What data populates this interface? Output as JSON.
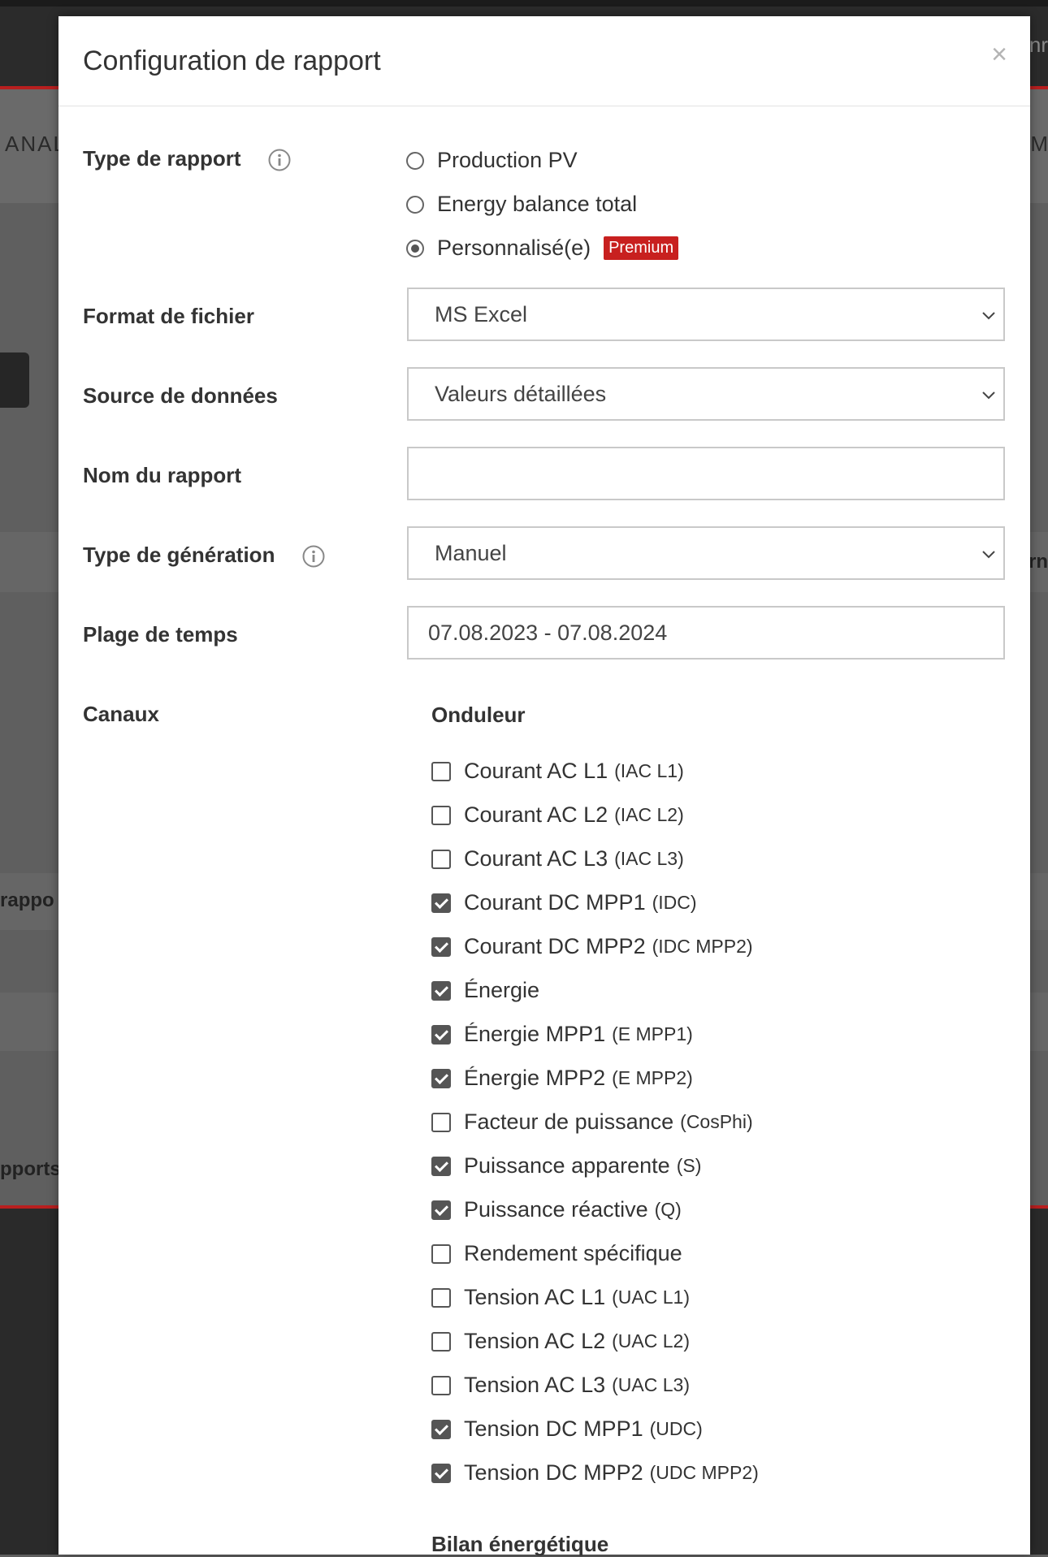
{
  "background": {
    "nav_left": "ANAL",
    "nav_right": "M",
    "header_right": "Enr",
    "row_right": "rn",
    "row_left_1": "rappo",
    "row_left_2": "pports"
  },
  "modal": {
    "title": "Configuration de rapport",
    "close_label": "×"
  },
  "report_type": {
    "label": "Type de rapport",
    "options": [
      {
        "label": "Production PV",
        "checked": false
      },
      {
        "label": "Energy balance total",
        "checked": false
      },
      {
        "label": "Personnalisé(e)",
        "checked": true,
        "badge": "Premium"
      }
    ]
  },
  "file_format": {
    "label": "Format de fichier",
    "value": "MS Excel"
  },
  "data_source": {
    "label": "Source de données",
    "value": "Valeurs détaillées"
  },
  "report_name": {
    "label": "Nom du rapport",
    "value": ""
  },
  "generation_type": {
    "label": "Type de génération",
    "value": "Manuel"
  },
  "time_range": {
    "label": "Plage de temps",
    "value": "07.08.2023 - 07.08.2024"
  },
  "channels": {
    "label": "Canaux",
    "groups": [
      {
        "title": "Onduleur",
        "items": [
          {
            "label": "Courant AC L1",
            "code": "(IAC L1)",
            "checked": false
          },
          {
            "label": "Courant AC L2",
            "code": "(IAC L2)",
            "checked": false
          },
          {
            "label": "Courant AC L3",
            "code": "(IAC L3)",
            "checked": false
          },
          {
            "label": "Courant DC MPP1",
            "code": "(IDC)",
            "checked": true
          },
          {
            "label": "Courant DC MPP2",
            "code": "(IDC MPP2)",
            "checked": true
          },
          {
            "label": "Énergie",
            "code": "",
            "checked": true
          },
          {
            "label": "Énergie MPP1",
            "code": "(E MPP1)",
            "checked": true
          },
          {
            "label": "Énergie MPP2",
            "code": "(E MPP2)",
            "checked": true
          },
          {
            "label": "Facteur de puissance",
            "code": "(CosPhi)",
            "checked": false
          },
          {
            "label": "Puissance apparente",
            "code": "(S)",
            "checked": true
          },
          {
            "label": "Puissance réactive",
            "code": "(Q)",
            "checked": true
          },
          {
            "label": "Rendement spécifique",
            "code": "",
            "checked": false
          },
          {
            "label": "Tension AC L1",
            "code": "(UAC L1)",
            "checked": false
          },
          {
            "label": "Tension AC L2",
            "code": "(UAC L2)",
            "checked": false
          },
          {
            "label": "Tension AC L3",
            "code": "(UAC L3)",
            "checked": false
          },
          {
            "label": "Tension DC MPP1",
            "code": "(UDC)",
            "checked": true
          },
          {
            "label": "Tension DC MPP2",
            "code": "(UDC MPP2)",
            "checked": true
          }
        ]
      },
      {
        "title": "Bilan énergétique",
        "items": []
      }
    ]
  }
}
